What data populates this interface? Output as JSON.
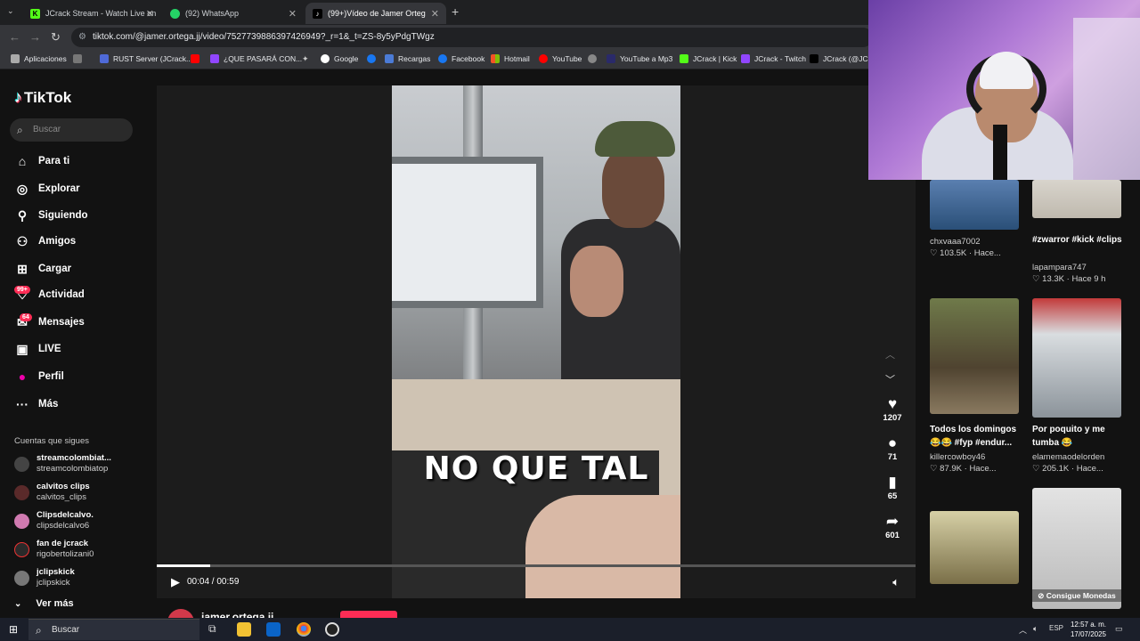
{
  "browser": {
    "tabs": [
      {
        "label": "JCrack Stream - Watch Live on K",
        "active": false
      },
      {
        "label": "(92) WhatsApp",
        "active": false
      },
      {
        "label": "(99+)Vídeo de Jamer Orteg",
        "active": true
      }
    ],
    "new_tab": "+",
    "url": "tiktok.com/@jamer.ortega.jj/video/7527739886397426949?_r=1&_t=ZS-8y5yPdgTWgz",
    "bookmarks": [
      "Aplicaciones",
      "RUST Server (JCrack...",
      "¿QUE PASARÁ CON...",
      "Google",
      "Recargas",
      "Facebook",
      "Hotmail",
      "YouTube",
      "YouTube a Mp3",
      "JCrack | Kick",
      "JCrack - Twitch",
      "JCrack (@JCra"
    ]
  },
  "tiktok": {
    "logo": "TikTok",
    "search_placeholder": "Buscar",
    "nav": [
      {
        "label": "Para ti",
        "icon": "home-icon"
      },
      {
        "label": "Explorar",
        "icon": "compass-icon"
      },
      {
        "label": "Siguiendo",
        "icon": "following-icon"
      },
      {
        "label": "Amigos",
        "icon": "friends-icon"
      },
      {
        "label": "Cargar",
        "icon": "upload-icon"
      },
      {
        "label": "Actividad",
        "icon": "activity-icon",
        "badge": "99+"
      },
      {
        "label": "Mensajes",
        "icon": "messages-icon",
        "badge": "64"
      },
      {
        "label": "LIVE",
        "icon": "live-icon"
      },
      {
        "label": "Perfil",
        "icon": "profile-icon"
      },
      {
        "label": "Más",
        "icon": "more-icon"
      }
    ],
    "following_title": "Cuentas que sigues",
    "following": [
      {
        "name": "streamcolombiat...",
        "handle": "streamcolombiatop"
      },
      {
        "name": "calvitos clips",
        "handle": "calvitos_clips"
      },
      {
        "name": "Clipsdelcalvo.",
        "handle": "clipsdelcalvo6"
      },
      {
        "name": "fan de jcrack",
        "handle": "rigobertolizani0"
      },
      {
        "name": "jclipskick",
        "handle": "jclipskick"
      }
    ],
    "see_more": "Ver más"
  },
  "video": {
    "caption": "NO QUE TAL",
    "time_current": "00:04",
    "time_total": "00:59",
    "progress": 0.07,
    "likes": "1207",
    "comments": "71",
    "saves": "65",
    "shares": "601",
    "author": "jamer.ortega.jj"
  },
  "related": [
    {
      "title": "",
      "user": "chxvaaa7002",
      "likes": "103.5K",
      "age": "Hace..."
    },
    {
      "title": "#zwarror #kick #clips",
      "user": "lapampara747",
      "likes": "13.3K",
      "age": "Hace 9 h"
    },
    {
      "title": "Todos los domingos 😂😂 #fyp #endur...",
      "user": "killercowboy46",
      "likes": "87.9K",
      "age": "Hace..."
    },
    {
      "title": "Por poquito y me tumba 😂",
      "user": "elamemaodelorden",
      "likes": "205.1K",
      "age": "Hace..."
    },
    {
      "title": "",
      "user": "",
      "likes": "",
      "age": ""
    },
    {
      "title": "",
      "user": "",
      "likes": "",
      "age": "",
      "overlay": "Consigue Monedas"
    }
  ],
  "taskbar": {
    "search": "Buscar",
    "lang": "ESP",
    "time": "12:57 a. m.",
    "date": "17/07/2025"
  }
}
